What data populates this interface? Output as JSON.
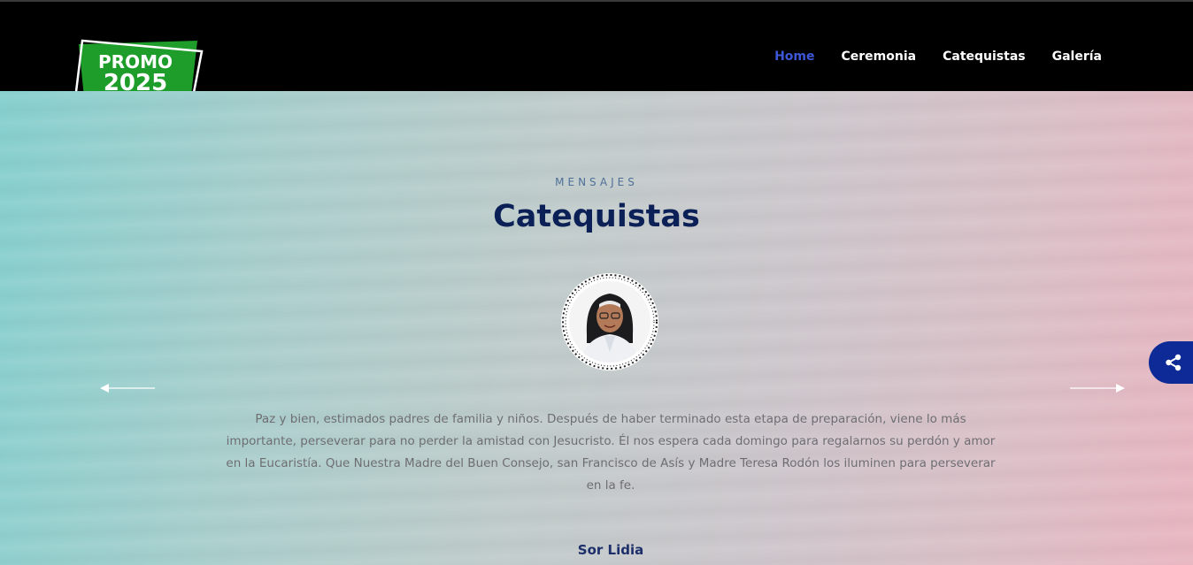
{
  "logo": {
    "line1": "PROMO",
    "line2": "2025"
  },
  "nav": {
    "items": [
      {
        "label": "Home",
        "active": true
      },
      {
        "label": "Ceremonia",
        "active": false
      },
      {
        "label": "Catequistas",
        "active": false
      },
      {
        "label": "Galería",
        "active": false
      }
    ]
  },
  "section": {
    "eyebrow": "MENSAJES",
    "title": "Catequistas"
  },
  "testimonial": {
    "message": "Paz y bien, estimados padres de familia y niños. Después de haber terminado esta etapa de preparación, viene lo más importante, perseverar para no perder la amistad con Jesucristo. Él nos espera cada domingo para regalarnos su perdón y amor en la Eucaristía. Que Nuestra Madre del Buen Consejo, san Francisco de Asís y Madre Teresa Rodón los iluminen para perseverar en la fe.",
    "name": "Sor Lidia"
  },
  "icons": {
    "prev": "arrow-left-icon",
    "next": "arrow-right-icon",
    "share": "share-icon"
  },
  "colors": {
    "header_bg": "#000000",
    "nav_active": "#3d57d6",
    "title": "#0b2056",
    "share_button": "#0d2a96",
    "logo_green": "#1f9d2b"
  }
}
